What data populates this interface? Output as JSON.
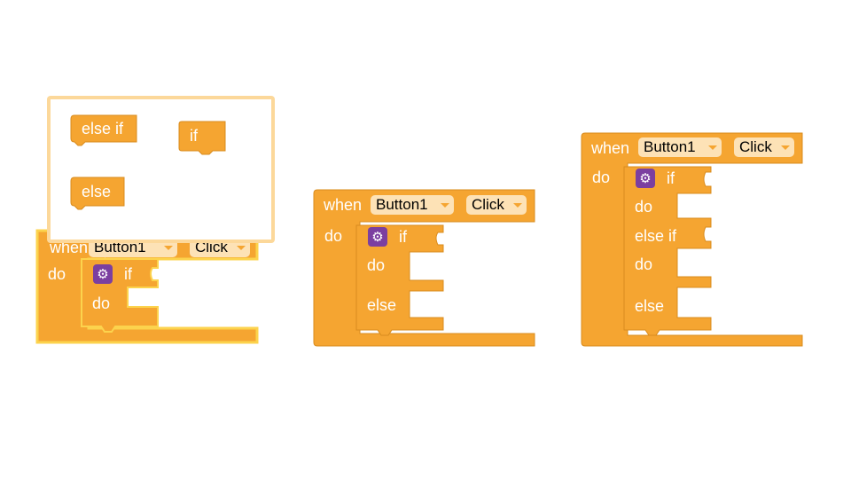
{
  "colors": {
    "block_fill": "#f5a531",
    "block_stroke": "#d98c1e",
    "dropdown_fill": "#fde2b6",
    "gear_fill": "#7b3fa0",
    "selected_outline": "#fcd34d",
    "mutator_bg": "#ffffff",
    "mutator_border": "#fcd89a"
  },
  "icons": {
    "mutator": "gear-icon",
    "dropdown": "triangle-down-icon"
  },
  "mutator": {
    "items": [
      {
        "label": "else if"
      },
      {
        "label": "if"
      },
      {
        "label": "else"
      }
    ]
  },
  "block1": {
    "when": "when",
    "component": "Button1",
    "event": "Click",
    "do": "do",
    "if": "if",
    "if_do": "do"
  },
  "block2": {
    "when": "when",
    "component": "Button1",
    "event": "Click",
    "do": "do",
    "if": "if",
    "if_do": "do",
    "else": "else"
  },
  "block3": {
    "when": "when",
    "component": "Button1",
    "event": "Click",
    "do": "do",
    "if": "if",
    "if_do": "do",
    "elseif": "else if",
    "elseif_do": "do",
    "else": "else"
  }
}
